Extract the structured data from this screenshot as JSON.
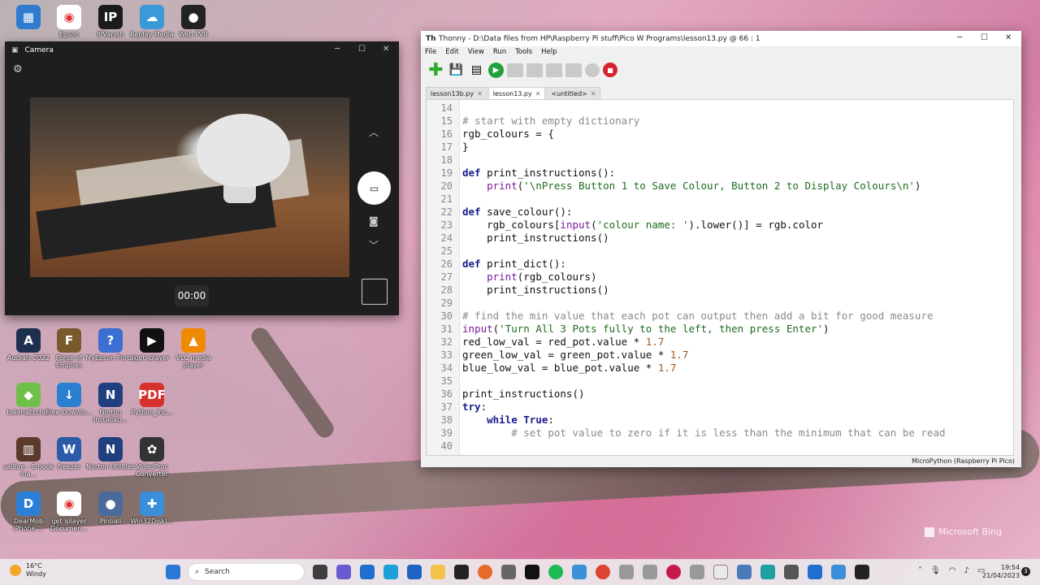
{
  "desktop_icons": [
    {
      "label": "",
      "color": "#2e7bcf",
      "glyph": "▦"
    },
    {
      "label": "Epson",
      "color": "#ffffff",
      "glyph": "◉"
    },
    {
      "label": "IPVanish",
      "color": "#1b1b1b",
      "glyph": "IP"
    },
    {
      "label": "Replay Media",
      "color": "#3a9ad9",
      "glyph": "☁"
    },
    {
      "label": "Web PVR",
      "color": "#222222",
      "glyph": "●"
    },
    {
      "label": "Audials 2022",
      "color": "#1f2f4f",
      "glyph": "A"
    },
    {
      "label": "Forge of Empires",
      "color": "#7a5a2a",
      "glyph": "F"
    },
    {
      "label": "MyEpson Portal",
      "color": "#3b6fd1",
      "glyph": "?"
    },
    {
      "label": "get iplayer",
      "color": "#111111",
      "glyph": "▶"
    },
    {
      "label": "VLC media player",
      "color": "#f08a00",
      "glyph": "▲"
    },
    {
      "label": "balenaEtcher",
      "color": "#6fc04a",
      "glyph": "◆"
    },
    {
      "label": "Free Downlo...",
      "color": "#2a7fd0",
      "glyph": "↓"
    },
    {
      "label": "Norton Installati...",
      "color": "#1f3f7f",
      "glyph": "N"
    },
    {
      "label": "Python_Inc...",
      "color": "#d8302a",
      "glyph": "PDF"
    },
    {
      "label": "calibre - E-book ma...",
      "color": "#5a3a2a",
      "glyph": "▥"
    },
    {
      "label": "freezer",
      "color": "#2a5aa8",
      "glyph": "W"
    },
    {
      "label": "Norton Utilities",
      "color": "#1f3f7f",
      "glyph": "N"
    },
    {
      "label": "VideoProc Converter",
      "color": "#333333",
      "glyph": "✿"
    },
    {
      "label": "DearMob iPhone ...",
      "color": "#2b7fd6",
      "glyph": "D"
    },
    {
      "label": "get iplayer Documen...",
      "color": "#ffffff",
      "glyph": "◉"
    },
    {
      "label": "Pinball",
      "color": "#4a6a9a",
      "glyph": "●"
    },
    {
      "label": "Win32DiskI...",
      "color": "#3b8fd8",
      "glyph": "✚"
    }
  ],
  "camera": {
    "title": "Camera",
    "timer": "00:00",
    "icons": {
      "settings": "gear-icon",
      "video": "video-camera-icon",
      "photo": "photo-camera-icon",
      "chevron_up": "chevron-up-icon",
      "chevron_down": "chevron-down-icon"
    }
  },
  "thonny": {
    "title": "Thonny  -  D:\\Data files from HP\\Raspberry Pi stuff\\Pico W Programs\\lesson13.py  @  66 : 1",
    "menu": [
      "File",
      "Edit",
      "View",
      "Run",
      "Tools",
      "Help"
    ],
    "tabs": [
      {
        "label": "lesson13b.py",
        "active": false
      },
      {
        "label": "lesson13.py",
        "active": true
      },
      {
        "label": "<untitled>",
        "active": false
      }
    ],
    "status": "MicroPython (Raspberry Pi Pico)",
    "code_lines": [
      {
        "n": "14",
        "t": ""
      },
      {
        "n": "15",
        "t": "# start with empty dictionary"
      },
      {
        "n": "16",
        "t": "rgb_colours = {"
      },
      {
        "n": "17",
        "t": "}"
      },
      {
        "n": "18",
        "t": ""
      },
      {
        "n": "19",
        "t": "def print_instructions():"
      },
      {
        "n": "20",
        "t": "    print('\\nPress Button 1 to Save Colour, Button 2 to Display Colours\\n')"
      },
      {
        "n": "21",
        "t": ""
      },
      {
        "n": "22",
        "t": "def save_colour():"
      },
      {
        "n": "23",
        "t": "    rgb_colours[input('colour name: ').lower()] = rgb.color"
      },
      {
        "n": "24",
        "t": "    print_instructions()"
      },
      {
        "n": "25",
        "t": ""
      },
      {
        "n": "26",
        "t": "def print_dict():"
      },
      {
        "n": "27",
        "t": "    print(rgb_colours)"
      },
      {
        "n": "28",
        "t": "    print_instructions()"
      },
      {
        "n": "29",
        "t": ""
      },
      {
        "n": "30",
        "t": "# find the min value that each pot can output then add a bit for good measure"
      },
      {
        "n": "31",
        "t": "input('Turn All 3 Pots fully to the left, then press Enter')"
      },
      {
        "n": "32",
        "t": "red_low_val = red_pot.value * 1.7"
      },
      {
        "n": "33",
        "t": "green_low_val = green_pot.value * 1.7"
      },
      {
        "n": "34",
        "t": "blue_low_val = blue_pot.value * 1.7"
      },
      {
        "n": "35",
        "t": ""
      },
      {
        "n": "36",
        "t": "print_instructions()"
      },
      {
        "n": "37",
        "t": "try:"
      },
      {
        "n": "38",
        "t": "    while True:"
      },
      {
        "n": "39",
        "t": "        # set pot value to zero if it is less than the minimum that can be read"
      },
      {
        "n": "40",
        "t": ""
      }
    ]
  },
  "watermark": "Microsoft Bing",
  "taskbar": {
    "weather_temp": "16°C",
    "weather_desc": "Windy",
    "search_placeholder": "Search",
    "time": "19:54",
    "date": "21/04/2023",
    "notifications": "3"
  }
}
